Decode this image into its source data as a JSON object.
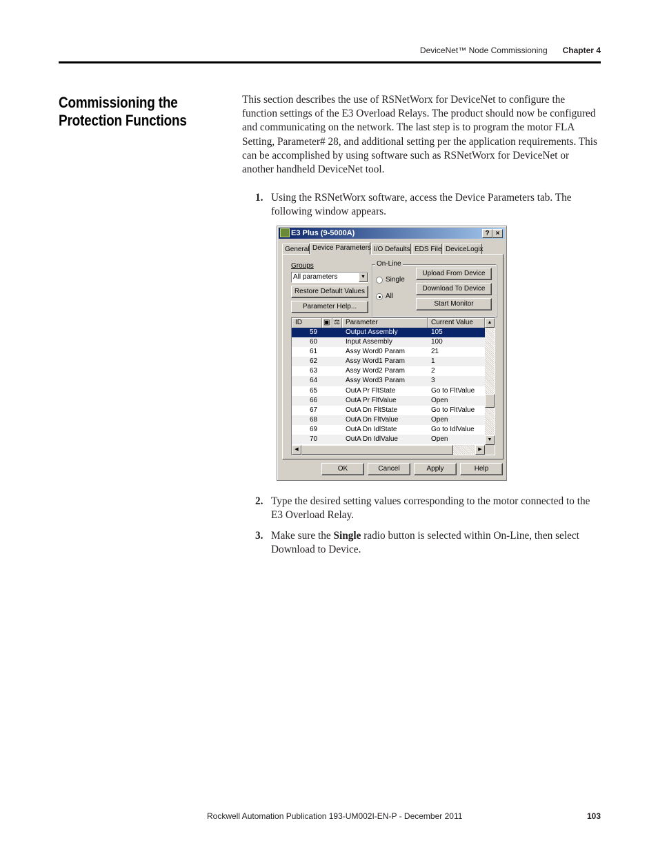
{
  "header": {
    "section": "DeviceNet™ Node Commissioning",
    "chapter": "Chapter 4"
  },
  "heading": "Commissioning the Protection Functions",
  "intro": "This section describes the use of RSNetWorx for DeviceNet to configure the function settings of the E3 Overload Relays. The product should now be configured and communicating on the network. The last step is to program the motor FLA Setting, Parameter# 28, and additional setting per the application requirements. This can be accomplished by using software such as RSNetWorx for DeviceNet or another handheld DeviceNet tool.",
  "steps": [
    {
      "num": "1.",
      "text": "Using the RSNetWorx software, access the Device Parameters tab. The following window appears."
    },
    {
      "num": "2.",
      "text": "Type the desired setting values corresponding to the motor connected to the E3 Overload Relay."
    },
    {
      "num": "3.",
      "pre": "Make sure the ",
      "bold": "Single",
      "post": " radio button is selected within On-Line, then select Download to Device."
    }
  ],
  "dialog": {
    "title": "E3 Plus (9-5000A)",
    "help_btn": "?",
    "close_btn": "×",
    "tabs": [
      "General",
      "Device Parameters",
      "I/O Defaults",
      "EDS File",
      "DeviceLogix"
    ],
    "active_tab": "Device Parameters",
    "groups_label": "Groups",
    "groups_value": "All parameters",
    "restore_btn": "Restore Default Values",
    "param_help_btn": "Parameter Help...",
    "online_label": "On-Line",
    "radio_single": "Single",
    "radio_all": "All",
    "radio_selected": "All",
    "upload_btn": "Upload From Device",
    "download_btn": "Download To Device",
    "monitor_btn": "Start Monitor",
    "columns": [
      "ID",
      "Parameter",
      "Current Value"
    ],
    "rows": [
      {
        "id": "59",
        "param": "Output Assembly",
        "value": "105",
        "selected": true
      },
      {
        "id": "60",
        "param": "Input Assembly",
        "value": "100"
      },
      {
        "id": "61",
        "param": "Assy Word0 Param",
        "value": "21"
      },
      {
        "id": "62",
        "param": "Assy Word1 Param",
        "value": "1"
      },
      {
        "id": "63",
        "param": "Assy Word2 Param",
        "value": "2"
      },
      {
        "id": "64",
        "param": "Assy Word3 Param",
        "value": "3"
      },
      {
        "id": "65",
        "param": "OutA Pr FltState",
        "value": "Go to FltValue"
      },
      {
        "id": "66",
        "param": "OutA Pr FltValue",
        "value": "Open"
      },
      {
        "id": "67",
        "param": "OutA Dn FltState",
        "value": "Go to FltValue"
      },
      {
        "id": "68",
        "param": "OutA Dn FltValue",
        "value": "Open"
      },
      {
        "id": "69",
        "param": "OutA Dn IdlState",
        "value": "Go to IdlValue"
      },
      {
        "id": "70",
        "param": "OutA Dn IdlValue",
        "value": "Open"
      }
    ],
    "ok_btn": "OK",
    "cancel_btn": "Cancel",
    "apply_btn": "Apply",
    "help2_btn": "Help"
  },
  "footer": {
    "publication": "Rockwell Automation Publication 193-UM002I-EN-P - December 2011",
    "page": "103"
  }
}
